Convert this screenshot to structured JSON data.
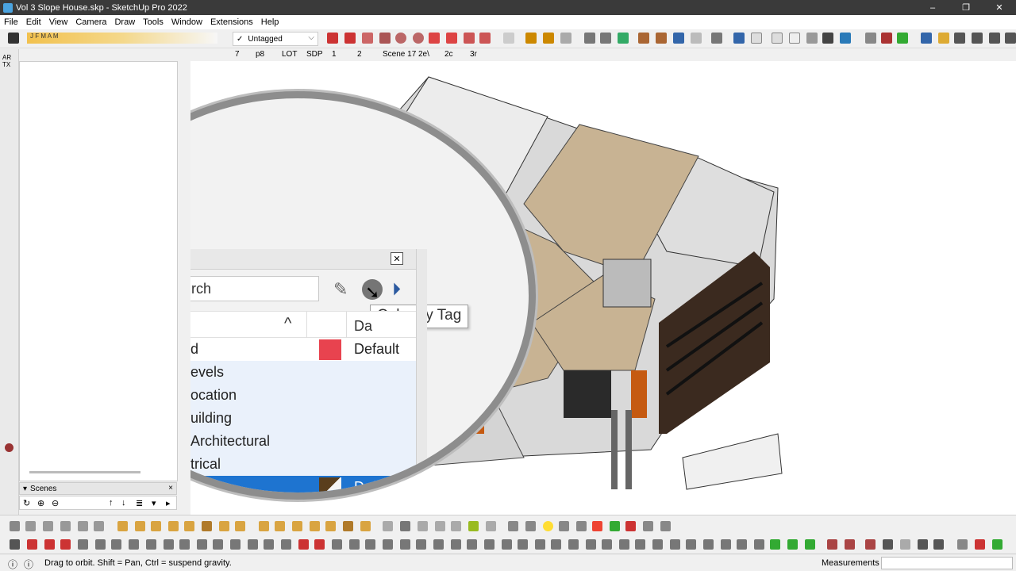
{
  "window": {
    "title": "Vol 3 Slope House.skp - SketchUp Pro 2022",
    "minimize": "–",
    "maximize": "❐",
    "close": "✕"
  },
  "menu": [
    "File",
    "Edit",
    "View",
    "Camera",
    "Draw",
    "Tools",
    "Window",
    "Extensions",
    "Help"
  ],
  "tag_selector": {
    "check": "✓",
    "value": "Untagged"
  },
  "ruler_letters": "J F M A M",
  "scene_tabs": [
    "7",
    "p8",
    "LOT",
    "SDP",
    "1",
    "2",
    "Scene 17",
    "2e\\",
    "2c",
    "3r"
  ],
  "left_strip": {
    "ar_label": "AR TX"
  },
  "scenes_panel": {
    "title": "Scenes",
    "close": "×",
    "icons": [
      "↻",
      "⊕",
      "⊖",
      "↑",
      "↓",
      "≣",
      "▾",
      "▸"
    ]
  },
  "magnifier": {
    "close": "✕",
    "search_placeholder": "rch",
    "pencil": "✎",
    "cursor": "➘",
    "detail": "⏵",
    "tooltip": "Color by Tag",
    "caret": "^",
    "dash_col": "Da",
    "rows": [
      {
        "name": "d",
        "dash": "Default",
        "swatch": "#e8434f"
      },
      {
        "name": "evels",
        "dash": "",
        "swatch": ""
      },
      {
        "name": "ocation",
        "dash": "",
        "swatch": ""
      },
      {
        "name": "uilding",
        "dash": "",
        "swatch": ""
      },
      {
        "name": "Architectural",
        "dash": "",
        "swatch": ""
      },
      {
        "name": "trical",
        "dash": "",
        "swatch": ""
      },
      {
        "name": "",
        "dash": "Default",
        "swatch": "split-brown-white"
      }
    ]
  },
  "status": {
    "hint": "Drag to orbit. Shift = Pan, Ctrl = suspend gravity.",
    "measurements": "Measurements"
  }
}
